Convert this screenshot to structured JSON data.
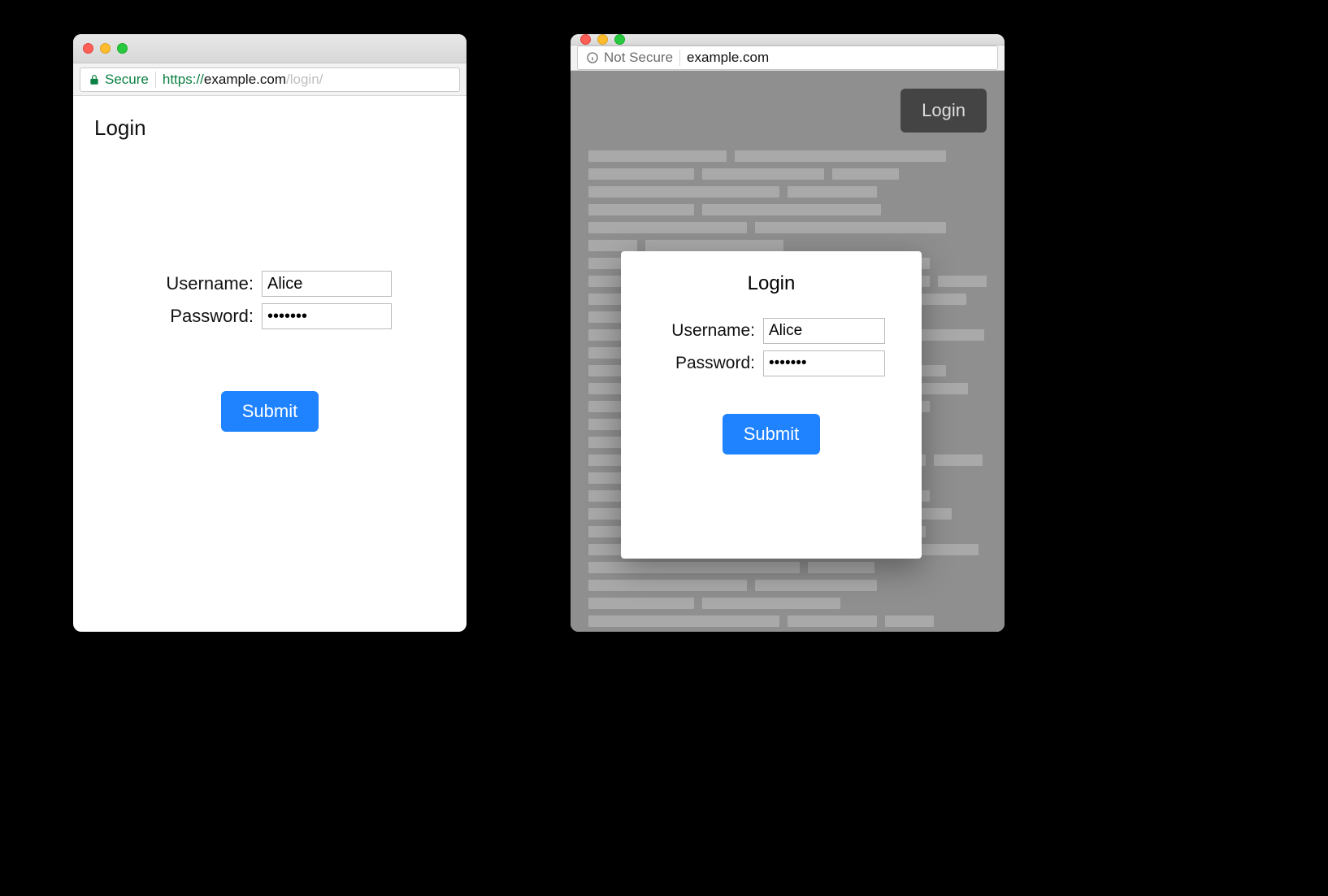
{
  "left": {
    "address": {
      "secure_label": "Secure",
      "scheme": "https",
      "host": "example.com",
      "path": "/login/"
    },
    "page": {
      "title": "Login",
      "username_label": "Username:",
      "username_value": "Alice",
      "password_label": "Password:",
      "password_value": "•••••••",
      "submit_label": "Submit"
    }
  },
  "right": {
    "address": {
      "status_label": "Not Secure",
      "host": "example.com"
    },
    "page": {
      "login_button_label": "Login"
    },
    "modal": {
      "title": "Login",
      "username_label": "Username:",
      "username_value": "Alice",
      "password_label": "Password:",
      "password_value": "•••••••",
      "submit_label": "Submit"
    }
  },
  "colors": {
    "secure_green": "#0b8043",
    "submit_blue": "#1f82ff"
  }
}
